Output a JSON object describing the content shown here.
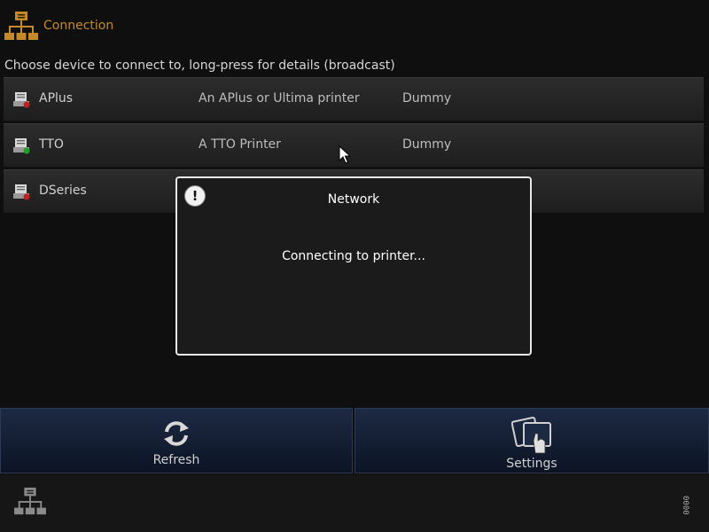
{
  "header": {
    "title": "Connection",
    "icon": "network-icon"
  },
  "instructions": "Choose device to connect to, long-press for details (broadcast)",
  "devices": [
    {
      "name": "APlus",
      "description": "An APlus or Ultima printer",
      "driver": "Dummy",
      "status_color": "#c02020"
    },
    {
      "name": "TTO",
      "description": "A TTO Printer",
      "driver": "Dummy",
      "status_color": "#20a020"
    },
    {
      "name": "DSeries",
      "description": "",
      "driver": "",
      "status_color": "#c02020"
    }
  ],
  "dialog": {
    "title": "Network",
    "message": "Connecting to printer...",
    "icon": "alert-icon"
  },
  "actions": {
    "refresh_label": "Refresh",
    "settings_label": "Settings"
  },
  "footer": {
    "code": "0000"
  },
  "colors": {
    "accent": "#c48a2a",
    "button_blue": "#1d2a44"
  }
}
